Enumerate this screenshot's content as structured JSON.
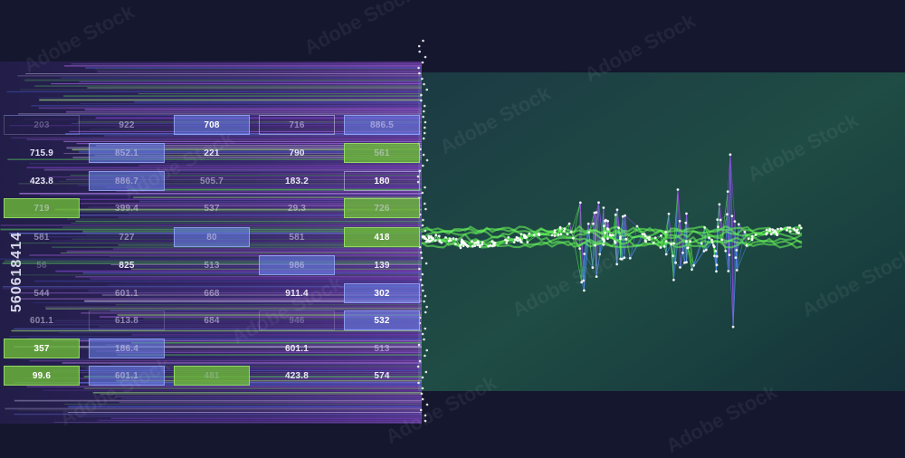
{
  "image_id_text": "560618414",
  "watermark": "Adobe Stock",
  "colors": {
    "background": "#15172f",
    "green_panel": "#1f4a42",
    "purple": "#9a3ee0",
    "green": "#4be04a",
    "blue": "#4a6fe0"
  },
  "table": {
    "rows": [
      [
        {
          "v": "203",
          "s": "outline-faint faint"
        },
        {
          "v": "922",
          "s": "dim"
        },
        {
          "v": "708",
          "s": "boxblue"
        },
        {
          "v": "716",
          "s": "outline dim"
        },
        {
          "v": "886.5",
          "s": "boxblue dim"
        }
      ],
      [
        {
          "v": "715.9",
          "s": "plain"
        },
        {
          "v": "852.1",
          "s": "boxblue dim"
        },
        {
          "v": "221",
          "s": "plain"
        },
        {
          "v": "790",
          "s": "plain"
        },
        {
          "v": "561",
          "s": "boxgreen dim"
        }
      ],
      [
        {
          "v": "423.8",
          "s": "plain"
        },
        {
          "v": "886.7",
          "s": "boxblue dim"
        },
        {
          "v": "505.7",
          "s": "dim"
        },
        {
          "v": "183.2",
          "s": "plain"
        },
        {
          "v": "180",
          "s": "outline"
        }
      ],
      [
        {
          "v": "719",
          "s": "boxgreen dim"
        },
        {
          "v": "399.4",
          "s": "dim"
        },
        {
          "v": "537",
          "s": "dim"
        },
        {
          "v": "29.3",
          "s": "dim"
        },
        {
          "v": "726",
          "s": "boxgreen dim"
        }
      ],
      [
        {
          "v": "581",
          "s": "dim"
        },
        {
          "v": "727",
          "s": "dim"
        },
        {
          "v": "80",
          "s": "boxblue dim"
        },
        {
          "v": "581",
          "s": "dim"
        },
        {
          "v": "418",
          "s": "boxgreen"
        }
      ],
      [
        {
          "v": "56",
          "s": "faint"
        },
        {
          "v": "825",
          "s": "plain"
        },
        {
          "v": "513",
          "s": "dim"
        },
        {
          "v": "986",
          "s": "boxblue dim"
        },
        {
          "v": "139",
          "s": "plain"
        }
      ],
      [
        {
          "v": "544",
          "s": "dim"
        },
        {
          "v": "601.1",
          "s": "dim"
        },
        {
          "v": "668",
          "s": "dim"
        },
        {
          "v": "911.4",
          "s": "plain"
        },
        {
          "v": "302",
          "s": "boxblue"
        }
      ],
      [
        {
          "v": "601.1",
          "s": "dim"
        },
        {
          "v": "613.8",
          "s": "outline-faint dim"
        },
        {
          "v": "684",
          "s": "dim"
        },
        {
          "v": "946",
          "s": "outline-faint faint"
        },
        {
          "v": "532",
          "s": "boxblue"
        }
      ],
      [
        {
          "v": "357",
          "s": "boxgreen"
        },
        {
          "v": "186.4",
          "s": "boxblue dim"
        },
        {
          "v": "",
          "s": ""
        },
        {
          "v": "601.1",
          "s": "plain"
        },
        {
          "v": "513",
          "s": "dim"
        }
      ],
      [
        {
          "v": "99.6",
          "s": "boxgreen"
        },
        {
          "v": "601.1",
          "s": "boxblue dim"
        },
        {
          "v": "481",
          "s": "boxgreen faint"
        },
        {
          "v": "423.8",
          "s": "plain"
        },
        {
          "v": "574",
          "s": "plain"
        }
      ]
    ]
  }
}
